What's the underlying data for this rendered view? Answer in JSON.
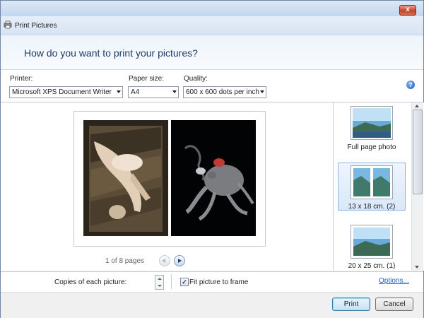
{
  "window": {
    "close_label": "x",
    "app_title": "Print Pictures",
    "icons": {
      "app": "printer-icon",
      "close": "close-icon",
      "help": "help-icon"
    }
  },
  "heading": "How do you want to print your pictures?",
  "options": {
    "printer_label": "Printer:",
    "printer_value": "Microsoft XPS Document Writer",
    "paper_label": "Paper size:",
    "paper_value": "A4",
    "quality_label": "Quality:",
    "quality_value": "600 x 600 dots per inch",
    "help_label": "?"
  },
  "preview": {
    "page_count": "1 of 8 pages",
    "photos": [
      "person-on-stairs-photo",
      "octopus-on-black-photo"
    ]
  },
  "layouts": [
    {
      "label": "Full page photo",
      "selected": false
    },
    {
      "label": "13 x 18 cm. (2)",
      "selected": true
    },
    {
      "label": "20 x 25 cm. (1)",
      "selected": false
    }
  ],
  "copies": {
    "label": "Copies of each picture:",
    "fit_label": "Fit picture to frame",
    "fit_checked": true,
    "check_glyph": "✓",
    "options_link": "Options..."
  },
  "footer": {
    "print_label": "Print",
    "cancel_label": "Cancel"
  }
}
